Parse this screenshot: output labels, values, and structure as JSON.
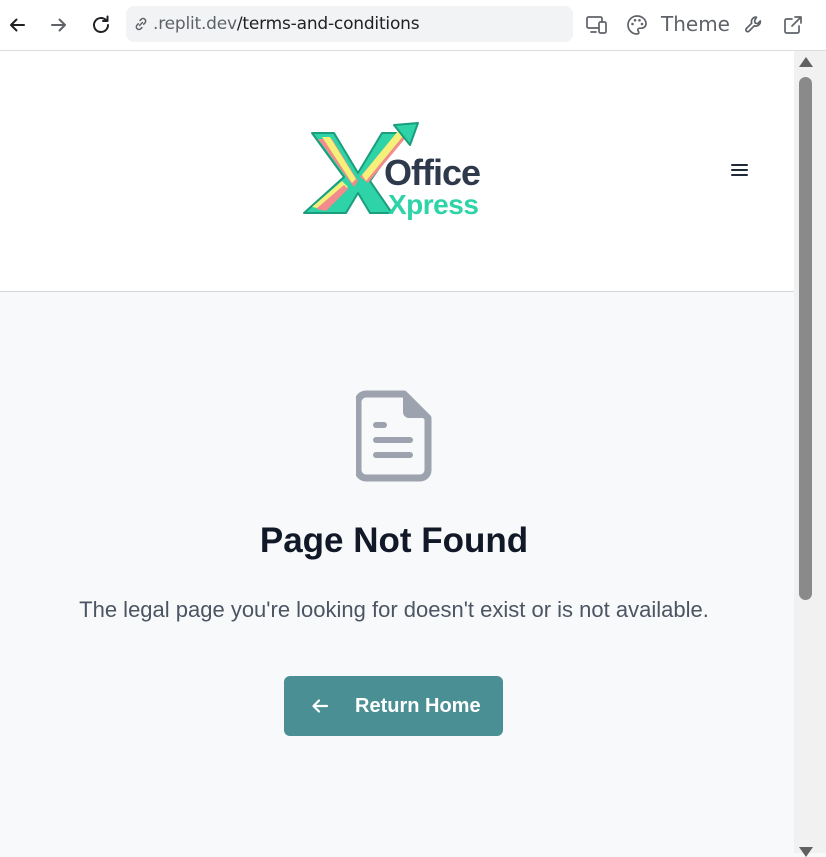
{
  "browser": {
    "url_host": ".replit.dev",
    "url_path": "/terms-and-conditions",
    "theme_label": "Theme",
    "icons": [
      "back-arrow-icon",
      "forward-arrow-icon",
      "reload-icon",
      "link-icon",
      "devices-icon",
      "palette-icon",
      "wrench-icon",
      "external-link-icon"
    ]
  },
  "header": {
    "logo_text_top": "Office",
    "logo_text_bottom": "Xpress",
    "menu_icon": "hamburger-menu-icon"
  },
  "main": {
    "icon": "document-icon",
    "title": "Page Not Found",
    "description": "The legal page you're looking for doesn't exist or is not available.",
    "button_label": "Return Home",
    "button_icon": "arrow-left-icon"
  },
  "colors": {
    "button_bg": "#4a8f94",
    "logo_dark": "#2e3a4b",
    "logo_teal": "#2ed3a7",
    "logo_pink": "#f28b8b",
    "logo_yellow": "#f4f07a",
    "icon_gray": "#9ca3af"
  }
}
